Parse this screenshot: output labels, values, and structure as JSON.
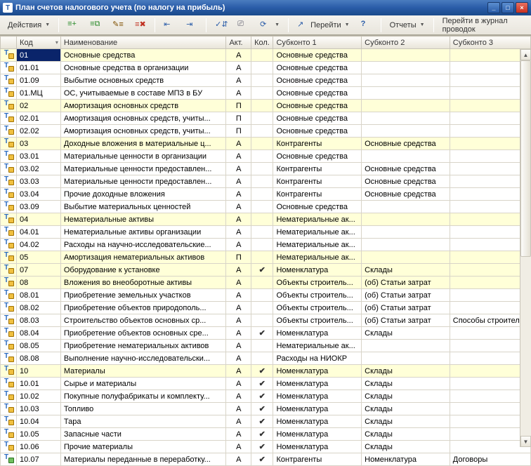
{
  "window": {
    "title": "План счетов налогового учета (по налогу на прибыль)",
    "min": "_",
    "max": "□",
    "close": "×"
  },
  "toolbar": {
    "actions": "Действия",
    "goto": "Перейти",
    "reports": "Отчеты",
    "journal": "Перейти в журнал проводок"
  },
  "headers": {
    "icon": "",
    "code": "Код",
    "name": "Наименование",
    "akt": "Акт.",
    "kol": "Кол.",
    "s1": "Субконто 1",
    "s2": "Субконто 2",
    "s3": "Субконто 3"
  },
  "rows": [
    {
      "ic": "y",
      "yl": true,
      "sel": true,
      "code": "01",
      "name": "Основные средства",
      "akt": "А",
      "kol": "",
      "s1": "Основные средства",
      "s2": "",
      "s3": ""
    },
    {
      "ic": "y",
      "code": "01.01",
      "name": "Основные средства в организации",
      "akt": "А",
      "kol": "",
      "s1": "Основные средства",
      "s2": "",
      "s3": ""
    },
    {
      "ic": "y",
      "code": "01.09",
      "name": "Выбытие основных средств",
      "akt": "А",
      "kol": "",
      "s1": "Основные средства",
      "s2": "",
      "s3": ""
    },
    {
      "ic": "y",
      "code": "01.МЦ",
      "name": "ОС, учитываемые в составе МПЗ в БУ",
      "akt": "А",
      "kol": "",
      "s1": "Основные средства",
      "s2": "",
      "s3": ""
    },
    {
      "ic": "y",
      "yl": true,
      "code": "02",
      "name": "Амортизация основных средств",
      "akt": "П",
      "kol": "",
      "s1": "Основные средства",
      "s2": "",
      "s3": ""
    },
    {
      "ic": "y",
      "code": "02.01",
      "name": "Амортизация основных средств, учиты...",
      "akt": "П",
      "kol": "",
      "s1": "Основные средства",
      "s2": "",
      "s3": ""
    },
    {
      "ic": "y",
      "code": "02.02",
      "name": "Амортизация основных средств, учиты...",
      "akt": "П",
      "kol": "",
      "s1": "Основные средства",
      "s2": "",
      "s3": ""
    },
    {
      "ic": "y",
      "yl": true,
      "code": "03",
      "name": "Доходные вложения в материальные ц...",
      "akt": "А",
      "kol": "",
      "s1": "Контрагенты",
      "s2": "Основные средства",
      "s3": ""
    },
    {
      "ic": "y",
      "code": "03.01",
      "name": "Материальные ценности в организации",
      "akt": "А",
      "kol": "",
      "s1": "Основные средства",
      "s2": "",
      "s3": ""
    },
    {
      "ic": "y",
      "code": "03.02",
      "name": "Материальные ценности предоставлен...",
      "akt": "А",
      "kol": "",
      "s1": "Контрагенты",
      "s2": "Основные средства",
      "s3": ""
    },
    {
      "ic": "y",
      "code": "03.03",
      "name": "Материальные ценности предоставлен...",
      "akt": "А",
      "kol": "",
      "s1": "Контрагенты",
      "s2": "Основные средства",
      "s3": ""
    },
    {
      "ic": "y",
      "code": "03.04",
      "name": "Прочие доходные вложения",
      "akt": "А",
      "kol": "",
      "s1": "Контрагенты",
      "s2": "Основные средства",
      "s3": ""
    },
    {
      "ic": "y",
      "code": "03.09",
      "name": "Выбытие материальных ценностей",
      "akt": "А",
      "kol": "",
      "s1": "Основные средства",
      "s2": "",
      "s3": ""
    },
    {
      "ic": "y",
      "yl": true,
      "code": "04",
      "name": "Нематериальные активы",
      "akt": "А",
      "kol": "",
      "s1": "Нематериальные ак...",
      "s2": "",
      "s3": ""
    },
    {
      "ic": "y",
      "code": "04.01",
      "name": "Нематериальные активы организации",
      "akt": "А",
      "kol": "",
      "s1": "Нематериальные ак...",
      "s2": "",
      "s3": ""
    },
    {
      "ic": "y",
      "code": "04.02",
      "name": "Расходы на научно-исследовательские...",
      "akt": "А",
      "kol": "",
      "s1": "Нематериальные ак...",
      "s2": "",
      "s3": ""
    },
    {
      "ic": "y",
      "yl": true,
      "code": "05",
      "name": "Амортизация нематериальных активов",
      "akt": "П",
      "kol": "",
      "s1": "Нематериальные ак...",
      "s2": "",
      "s3": ""
    },
    {
      "ic": "y",
      "yl": true,
      "code": "07",
      "name": "Оборудование к установке",
      "akt": "А",
      "kol": "✔",
      "s1": "Номенклатура",
      "s2": "Склады",
      "s3": ""
    },
    {
      "ic": "y",
      "yl": true,
      "code": "08",
      "name": "Вложения во внеоборотные активы",
      "akt": "А",
      "kol": "",
      "s1": "Объекты строитель...",
      "s2": "(об) Статьи затрат",
      "s3": ""
    },
    {
      "ic": "y",
      "code": "08.01",
      "name": "Приобретение земельных участков",
      "akt": "А",
      "kol": "",
      "s1": "Объекты строитель...",
      "s2": "(об) Статьи затрат",
      "s3": ""
    },
    {
      "ic": "y",
      "code": "08.02",
      "name": "Приобретение объектов природополь...",
      "akt": "А",
      "kol": "",
      "s1": "Объекты строитель...",
      "s2": "(об) Статьи затрат",
      "s3": ""
    },
    {
      "ic": "y",
      "code": "08.03",
      "name": "Строительство объектов основных ср...",
      "akt": "А",
      "kol": "",
      "s1": "Объекты строитель...",
      "s2": "(об) Статьи затрат",
      "s3": "Способы строитель..."
    },
    {
      "ic": "y",
      "code": "08.04",
      "name": "Приобретение объектов основных сре...",
      "akt": "А",
      "kol": "✔",
      "s1": "Номенклатура",
      "s2": "Склады",
      "s3": ""
    },
    {
      "ic": "y",
      "code": "08.05",
      "name": "Приобретение нематериальных активов",
      "akt": "А",
      "kol": "",
      "s1": "Нематериальные ак...",
      "s2": "",
      "s3": ""
    },
    {
      "ic": "y",
      "code": "08.08",
      "name": "Выполнение научно-исследовательски...",
      "akt": "А",
      "kol": "",
      "s1": "Расходы на НИОКР",
      "s2": "",
      "s3": ""
    },
    {
      "ic": "y",
      "yl": true,
      "code": "10",
      "name": "Материалы",
      "akt": "А",
      "kol": "✔",
      "s1": "Номенклатура",
      "s2": "Склады",
      "s3": ""
    },
    {
      "ic": "y",
      "code": "10.01",
      "name": "Сырье и материалы",
      "akt": "А",
      "kol": "✔",
      "s1": "Номенклатура",
      "s2": "Склады",
      "s3": ""
    },
    {
      "ic": "y",
      "code": "10.02",
      "name": "Покупные полуфабрикаты и комплекту...",
      "akt": "А",
      "kol": "✔",
      "s1": "Номенклатура",
      "s2": "Склады",
      "s3": ""
    },
    {
      "ic": "y",
      "code": "10.03",
      "name": "Топливо",
      "akt": "А",
      "kol": "✔",
      "s1": "Номенклатура",
      "s2": "Склады",
      "s3": ""
    },
    {
      "ic": "y",
      "code": "10.04",
      "name": "Тара",
      "akt": "А",
      "kol": "✔",
      "s1": "Номенклатура",
      "s2": "Склады",
      "s3": ""
    },
    {
      "ic": "y",
      "code": "10.05",
      "name": "Запасные части",
      "akt": "А",
      "kol": "✔",
      "s1": "Номенклатура",
      "s2": "Склады",
      "s3": ""
    },
    {
      "ic": "y",
      "code": "10.06",
      "name": "Прочие материалы",
      "akt": "А",
      "kol": "✔",
      "s1": "Номенклатура",
      "s2": "Склады",
      "s3": ""
    },
    {
      "ic": "g",
      "code": "10.07",
      "name": "Материалы переданные в переработку...",
      "akt": "А",
      "kol": "✔",
      "s1": "Контрагенты",
      "s2": "Номенклатура",
      "s3": "Договоры"
    }
  ]
}
